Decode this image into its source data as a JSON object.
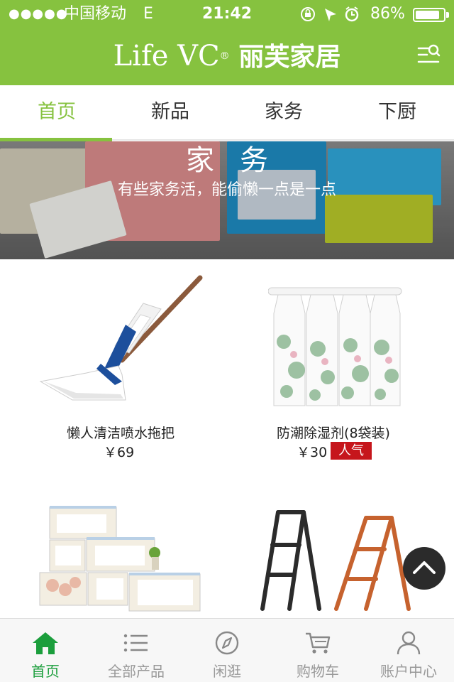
{
  "status_bar": {
    "signal": "●●●●●",
    "carrier": "中国移动",
    "network": "E",
    "time": "21:42",
    "battery_percent": "86%",
    "battery_level": 0.86
  },
  "header": {
    "brand_en": "Life VC",
    "brand_reg": "®",
    "brand_cn": "丽芙家居",
    "menu_icon": "menu-search-icon",
    "bg_color": "#86c23f"
  },
  "tabs": [
    {
      "label": "首页",
      "active": true
    },
    {
      "label": "新品",
      "active": false
    },
    {
      "label": "家务",
      "active": false
    },
    {
      "label": "下厨",
      "active": false
    }
  ],
  "banner": {
    "title": "家务",
    "subtitle": "有些家务活，能偷懒一点是一点"
  },
  "products": [
    {
      "name": "懒人清洁喷水拖把",
      "price": "￥69",
      "badge": ""
    },
    {
      "name": "防潮除湿剂(8袋装)",
      "price": "￥30",
      "badge": "人气"
    },
    {
      "name": "",
      "price": "",
      "badge": ""
    },
    {
      "name": "",
      "price": "",
      "badge": ""
    }
  ],
  "scroll_top_icon": "chevron-up-icon",
  "bottom_nav": [
    {
      "label": "首页",
      "icon": "home-icon",
      "active": true
    },
    {
      "label": "全部产品",
      "icon": "list-icon",
      "active": false
    },
    {
      "label": "闲逛",
      "icon": "compass-icon",
      "active": false
    },
    {
      "label": "购物车",
      "icon": "cart-icon",
      "active": false
    },
    {
      "label": "账户中心",
      "icon": "user-icon",
      "active": false
    }
  ],
  "colors": {
    "accent_green": "#86c23f",
    "nav_active": "#1b9e3c",
    "badge_red": "#c6161c"
  }
}
